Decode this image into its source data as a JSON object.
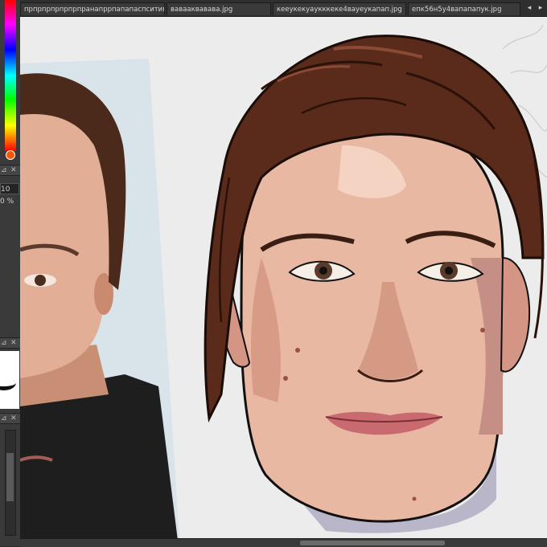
{
  "tabs": [
    "прпрпрпрпрпрпранапррпапапаспситимини.jpg",
    "вавааквавава.jpg",
    "кееукекуаукккеке4вауеукапап.jpg",
    "епк56н5у4вапапапук.jpg"
  ],
  "left_panel": {
    "brush_size": "10",
    "opacity_percent": "0 %",
    "pin_icon": "pin-icon",
    "close_icon": "close-icon"
  },
  "colors": {
    "canvas_bg": "#ececec",
    "hair": "#5a2a1a",
    "skin": "#e7b9a2",
    "lips": "#c86a6f",
    "ui_dark": "#2f2f2f"
  }
}
